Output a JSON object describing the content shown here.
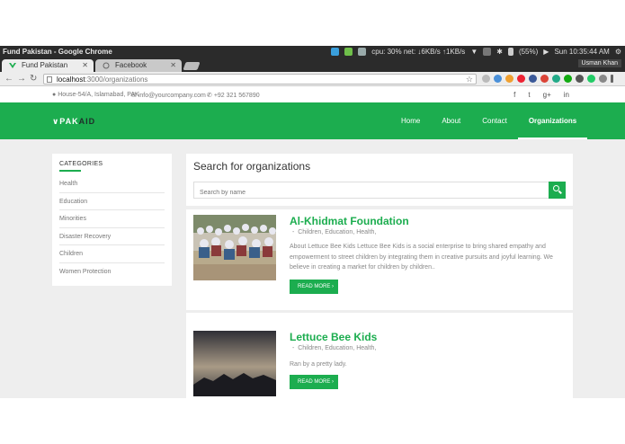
{
  "system": {
    "window_title": "Fund Pakistan - Google Chrome",
    "tray_text": "cpu: 30% net: ↓6KB/s ↑1KB/s",
    "battery": "(55%)",
    "clock": "Sun 10:35:44 AM"
  },
  "browser": {
    "tabs": [
      {
        "label": "Fund Pakistan"
      },
      {
        "label": "Facebook"
      }
    ],
    "user": "Usman Khan",
    "url_host": "localhost",
    "url_path": ":3000/organizations"
  },
  "site": {
    "info": {
      "address": "House-54/A, Islamabad, PAK",
      "email": "info@yourcompany.com",
      "phone": "+92 321 567890"
    },
    "socials": [
      "f",
      "t",
      "g+",
      "in"
    ],
    "logo": {
      "part1": "∨PAK",
      "part2": "AID"
    },
    "nav": [
      "Home",
      "About",
      "Contact",
      "Organizations"
    ],
    "accent": "#1cad4f"
  },
  "sidebar": {
    "heading": "CATEGORIES",
    "items": [
      "Health",
      "Education",
      "Minorities",
      "Disaster Recovery",
      "Children",
      "Women Protection"
    ]
  },
  "search": {
    "heading": "Search for organizations",
    "placeholder": "Search by name"
  },
  "organizations": [
    {
      "name": "Al-Khidmat Foundation",
      "tags": "Children, Education, Health,",
      "description": "About Lettuce Bee Kids Lettuce Bee Kids is a social enterprise to bring shared empathy and empowerment to street children by integrating them in creative pursuits and joyful learning. We believe in creating a market for children by children..",
      "button": "READ MORE ›"
    },
    {
      "name": "Lettuce Bee Kids",
      "tags": "Children, Education, Health,",
      "description": "Ran by a pretty lady.",
      "button": "READ MORE ›"
    }
  ]
}
